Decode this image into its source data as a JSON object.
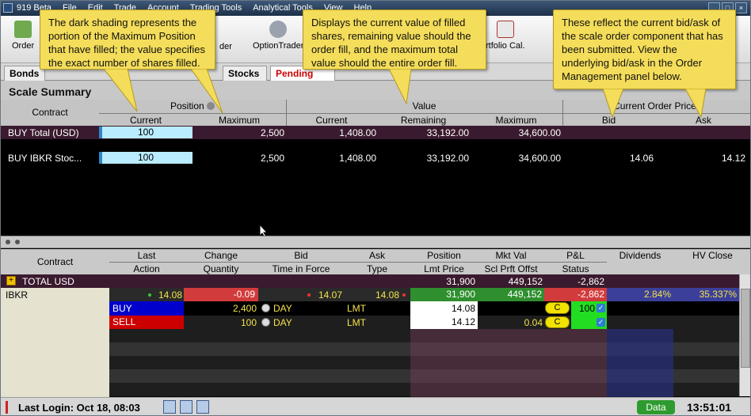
{
  "window": {
    "title": "919 Beta",
    "time": "13:51:01"
  },
  "menu": [
    "File",
    "Edit",
    "Trade",
    "Account",
    "Trading Tools",
    "Analytical Tools",
    "View",
    "Help"
  ],
  "toolbar": {
    "order": "Order",
    "order_partial": "der",
    "optiontrader": "OptionTrader",
    "portfolio": "rtfolio Cal."
  },
  "tabs": {
    "bonds": "Bonds",
    "stocks": "Stocks",
    "pending": "Pending"
  },
  "scale_summary": {
    "title": "Scale Summary",
    "group_headers": {
      "contract": "Contract",
      "position": "Position",
      "value": "Value",
      "order_prices": "Current Order Prices"
    },
    "columns": {
      "current": "Current",
      "maximum": "Maximum",
      "value_current": "Current",
      "remaining": "Remaining",
      "value_maximum": "Maximum",
      "bid": "Bid",
      "ask": "Ask"
    },
    "rows": [
      {
        "contract": "BUY Total (USD)",
        "current": "100",
        "maximum": "2,500",
        "value_current": "1,408.00",
        "remaining": "33,192.00",
        "value_maximum": "34,600.00",
        "bid": "",
        "ask": "",
        "fill_fraction": 0.04
      },
      {
        "contract": "BUY IBKR Stoc...",
        "current": "100",
        "maximum": "2,500",
        "value_current": "1,408.00",
        "remaining": "33,192.00",
        "value_maximum": "34,600.00",
        "bid": "14.06",
        "ask": "14.12",
        "fill_fraction": 0.04
      }
    ]
  },
  "orders": {
    "headers_top": [
      "Contract",
      "Last",
      "Change",
      "Bid",
      "Ask",
      "Position",
      "Mkt Val",
      "P&L",
      "Dividends",
      "HV Close"
    ],
    "headers_bottom": [
      "Action",
      "Quantity",
      "Time in Force",
      "Type",
      "Lmt Price",
      "Scl Prft Offst",
      "Status"
    ],
    "total": {
      "label": "TOTAL   USD",
      "position": "31,900",
      "mkt_val": "449,152",
      "pnl": "-2,862"
    },
    "ibkr": {
      "contract": "IBKR",
      "last": "14.08",
      "change": "-0.09",
      "bid": "14.07",
      "ask": "14.08",
      "position": "31,900",
      "mkt_val": "449,152",
      "pnl": "-2,862",
      "dividends": "2.84%",
      "hv_close": "35.337%"
    },
    "buy": {
      "action": "BUY",
      "quantity": "2,400",
      "tif": "DAY",
      "type": "LMT",
      "lmt_price": "14.08",
      "offset": "",
      "c": "C",
      "status_val": "100"
    },
    "sell": {
      "action": "SELL",
      "quantity": "100",
      "tif": "DAY",
      "type": "LMT",
      "lmt_price": "14.12",
      "offset": "0.04",
      "c": "C"
    }
  },
  "callouts": {
    "shading": "The dark shading represents the portion of the Maximum Position that have filled; the value specifies the exact number of shares filled.",
    "value": "Displays the current value of filled shares, remaining value should the order fill, and the maximum total value should the entire order fill.",
    "bidask": "These reflect the current bid/ask of the scale order component that has been submitted. View the underlying bid/ask in the Order Management panel below."
  },
  "status": {
    "last_login": "Last Login: Oct 18, 08:03",
    "data": "Data",
    "clock": "13:51:01"
  },
  "colors": {
    "accent_blue": "#2e86c7",
    "buy": "#0000cc",
    "sell": "#cc0000",
    "pnl_red": "#d23b3b",
    "green": "#2e9b2e",
    "callout": "#f4dd5a"
  }
}
